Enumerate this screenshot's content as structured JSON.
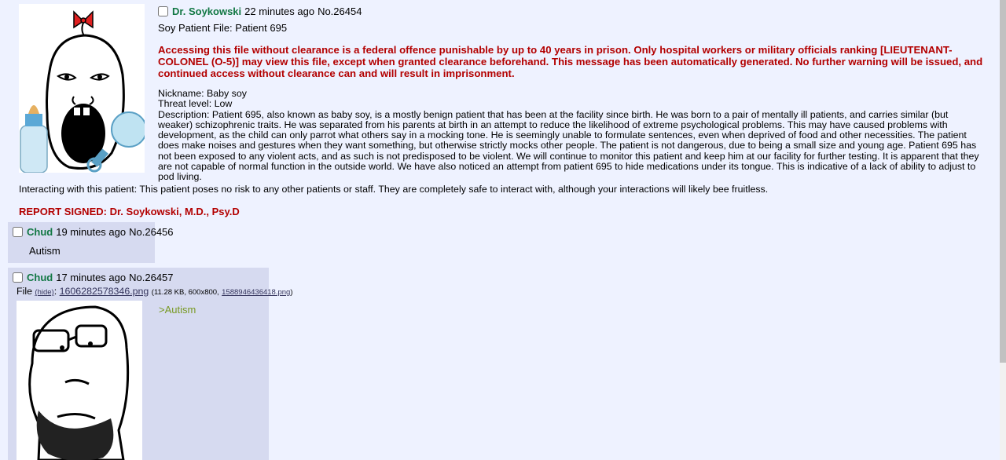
{
  "op": {
    "name": "Dr. Soykowski",
    "time": "22 minutes ago",
    "number": "No.26454",
    "subject": "Soy Patient File: Patient 695",
    "warning": "Accessing this file without clearance is a federal offence punishable by up to 40 years in prison. Only hospital workers or military officials ranking [LIEUTENANT-COLONEL (O-5)] may view this file, except when granted clearance beforehand. This message has been automatically generated. No further warning will be issued, and continued access without clearance can and will result in imprisonment.",
    "nickname": "Nickname: Baby soy",
    "threat": "Threat level: Low",
    "description": "Description: Patient 695, also known as baby soy, is a mostly benign patient that has been at the facility since birth. He was born to a pair of mentally ill patients, and carries similar (but weaker) schizophrenic traits. He was separated from his parents at birth in an attempt to reduce the likelihood of extreme psychological problems. This may have caused problems with development, as the child can only parrot what others say in a mocking tone. He is seemingly unable to formulate sentences, even when deprived of food and other necessities. The patient does make noises and gestures when they want something, but otherwise strictly mocks other people. The patient is not dangerous, due to being a small size and young age. Patient 695 has not been exposed to any violent acts, and as such is not predisposed to be violent. We will continue to monitor this patient and keep him at our facility for further testing. It is apparent that they are not capable of normal function in the outside world. We have also noticed an attempt from patient 695 to hide medications under its tongue. This is indicative of a lack of ability to adjust to pod living.",
    "interacting": "Interacting with this patient: This patient poses no risk to any other patients or staff. They are completely safe to interact with, although your interactions will likely bee fruitless.",
    "signed": "REPORT SIGNED: Dr. Soykowski, M.D., Psy.D"
  },
  "replies": [
    {
      "name": "Chud",
      "time": "19 minutes ago",
      "number": "No.26456",
      "text": "Autism"
    },
    {
      "name": "Chud",
      "time": "17 minutes ago",
      "number": "No.26457",
      "file_prefix": "File",
      "hide_label": "(hide)",
      "file_name": "1606282578346.png",
      "file_info": "(11.28 KB, 600x800,",
      "orig_name": "1588946436418.png",
      "file_suffix": ")",
      "text": ">Autism"
    }
  ]
}
